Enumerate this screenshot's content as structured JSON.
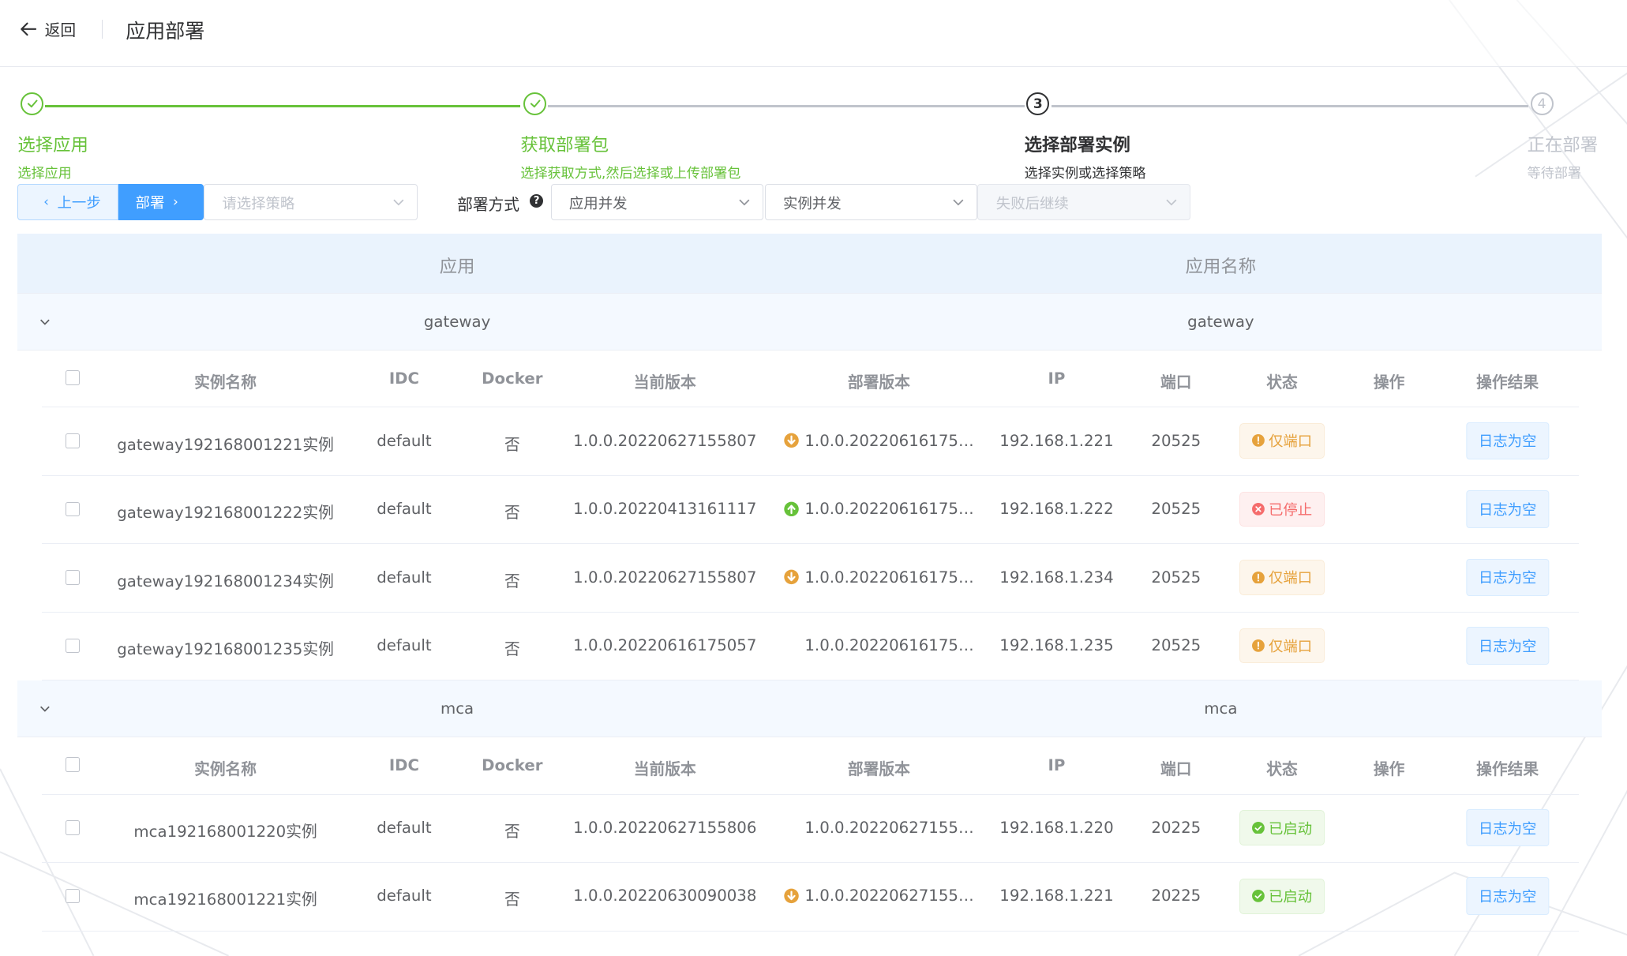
{
  "header": {
    "back_label": "返回",
    "title": "应用部署"
  },
  "steps": [
    {
      "title": "选择应用",
      "desc": "选择应用",
      "status": "finish"
    },
    {
      "title": "获取部署包",
      "desc": "选择获取方式,然后选择或上传部署包",
      "status": "finish"
    },
    {
      "number": "3",
      "title": "选择部署实例",
      "desc": "选择实例或选择策略",
      "status": "process"
    },
    {
      "number": "4",
      "title": "正在部署",
      "desc": "等待部署",
      "status": "wait"
    }
  ],
  "toolbar": {
    "prev_label": "上一步",
    "deploy_label": "部署",
    "strategy_placeholder": "请选择策略",
    "mode_label": "部署方式",
    "app_mode": "应用并发",
    "instance_mode": "实例并发",
    "failure_mode": "失败后继续"
  },
  "table": {
    "outer_headers": [
      "应用",
      "应用名称"
    ],
    "inner_headers": [
      "实例名称",
      "IDC",
      "Docker",
      "当前版本",
      "部署版本",
      "IP",
      "端口",
      "状态",
      "操作",
      "操作结果"
    ],
    "groups": [
      {
        "app": "gateway",
        "name": "gateway",
        "rows": [
          {
            "instance": "gateway192168001221实例",
            "idc": "default",
            "docker": "否",
            "current_version": "1.0.0.20220627155807",
            "deploy_version": "1.0.0.20220616175…",
            "version_icon": "down",
            "ip": "192.168.1.221",
            "port": "20525",
            "status": "仅端口",
            "status_type": "warn",
            "operation": "",
            "result": "日志为空"
          },
          {
            "instance": "gateway192168001222实例",
            "idc": "default",
            "docker": "否",
            "current_version": "1.0.0.20220413161117",
            "deploy_version": "1.0.0.20220616175…",
            "version_icon": "up",
            "ip": "192.168.1.222",
            "port": "20525",
            "status": "已停止",
            "status_type": "danger",
            "operation": "",
            "result": "日志为空"
          },
          {
            "instance": "gateway192168001234实例",
            "idc": "default",
            "docker": "否",
            "current_version": "1.0.0.20220627155807",
            "deploy_version": "1.0.0.20220616175…",
            "version_icon": "down",
            "ip": "192.168.1.234",
            "port": "20525",
            "status": "仅端口",
            "status_type": "warn",
            "operation": "",
            "result": "日志为空"
          },
          {
            "instance": "gateway192168001235实例",
            "idc": "default",
            "docker": "否",
            "current_version": "1.0.0.20220616175057",
            "deploy_version": "1.0.0.20220616175…",
            "version_icon": "none",
            "ip": "192.168.1.235",
            "port": "20525",
            "status": "仅端口",
            "status_type": "warn",
            "operation": "",
            "result": "日志为空"
          }
        ]
      },
      {
        "app": "mca",
        "name": "mca",
        "rows": [
          {
            "instance": "mca192168001220实例",
            "idc": "default",
            "docker": "否",
            "current_version": "1.0.0.20220627155806",
            "deploy_version": "1.0.0.20220627155…",
            "version_icon": "none",
            "ip": "192.168.1.220",
            "port": "20225",
            "status": "已启动",
            "status_type": "success",
            "operation": "",
            "result": "日志为空"
          },
          {
            "instance": "mca192168001221实例",
            "idc": "default",
            "docker": "否",
            "current_version": "1.0.0.20220630090038",
            "deploy_version": "1.0.0.20220627155…",
            "version_icon": "down",
            "ip": "192.168.1.221",
            "port": "20225",
            "status": "已启动",
            "status_type": "success",
            "operation": "",
            "result": "日志为空"
          }
        ]
      }
    ]
  },
  "colors": {
    "primary": "#409eff",
    "success": "#67c23a",
    "warning": "#e6a23c",
    "danger": "#f56c6c",
    "header_bg": "#eaf3fd",
    "group_bg": "#f4f9ff"
  }
}
